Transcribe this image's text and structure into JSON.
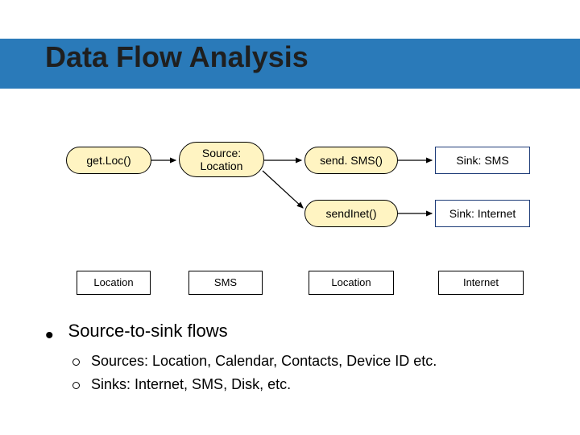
{
  "title": "Data Flow Analysis",
  "nodes": {
    "getLoc": {
      "label": "get.Loc()"
    },
    "source": {
      "label": "Source: Location"
    },
    "sendSMS": {
      "label": "send. SMS()"
    },
    "sinkSMS": {
      "label": "Sink: SMS"
    },
    "sendInet": {
      "label": "sendInet()"
    },
    "sinkInet": {
      "label": "Sink: Internet"
    },
    "r_location1": {
      "label": "Location"
    },
    "r_sms": {
      "label": "SMS"
    },
    "r_location2": {
      "label": "Location"
    },
    "r_internet": {
      "label": "Internet"
    }
  },
  "bullets": {
    "main": "Source-to-sink flows",
    "sub1": "Sources: Location, Calendar, Contacts, Device ID etc.",
    "sub2": "Sinks: Internet, SMS, Disk, etc."
  }
}
